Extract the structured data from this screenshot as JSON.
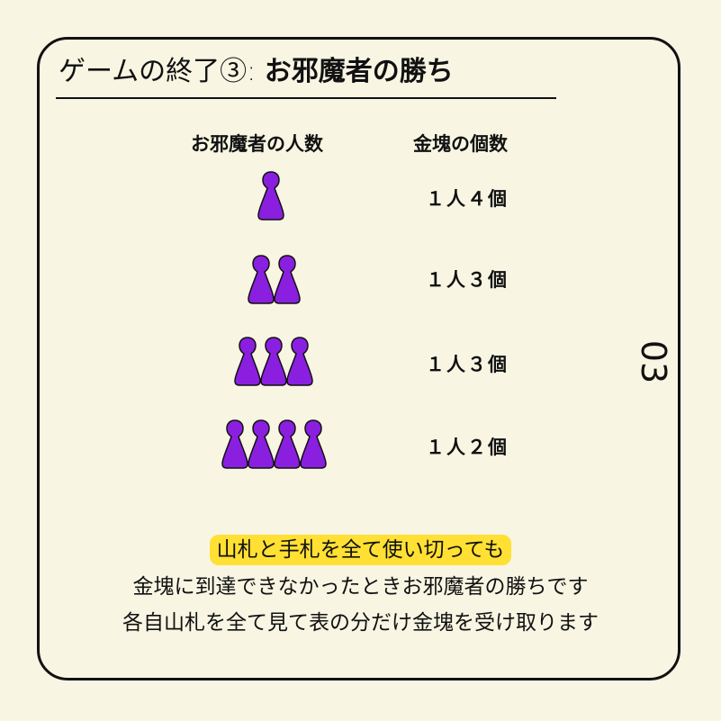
{
  "title": {
    "prefix": "ゲームの終了③: ",
    "main": "お邪魔者の勝ち"
  },
  "columns": {
    "players": "お邪魔者の人数",
    "gold": "金塊の個数"
  },
  "rows": [
    {
      "pawns": 1,
      "count": "１人４個"
    },
    {
      "pawns": 2,
      "count": "１人３個"
    },
    {
      "pawns": 3,
      "count": "１人３個"
    },
    {
      "pawns": 4,
      "count": "１人２個"
    }
  ],
  "page_number": "03",
  "footer": {
    "highlight": "山札と手札を全て使い切っても",
    "line2": "金塊に到達できなかったときお邪魔者の勝ちです",
    "line3": "各自山札を全て見て表の分だけ金塊を受け取ります"
  },
  "colors": {
    "pawn": "#8a1fe0",
    "highlight": "#ffe033",
    "background": "#f8f5e3"
  },
  "icons": {
    "pawn": "pawn-icon"
  }
}
